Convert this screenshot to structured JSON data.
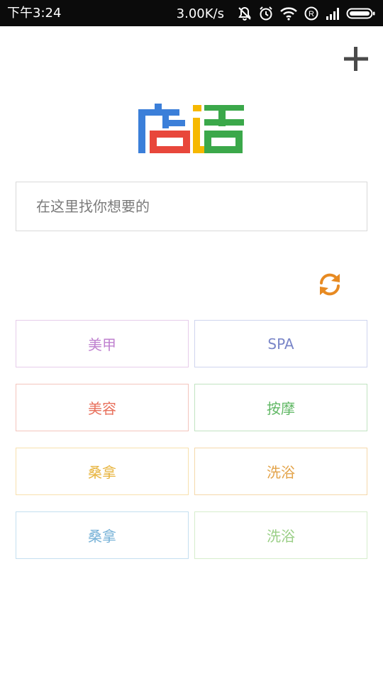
{
  "status_bar": {
    "time": "下午3:24",
    "net_speed": "3.00K/s",
    "icons": [
      "mute-icon",
      "alarm-icon",
      "wifi-icon",
      "registered-icon",
      "signal-icon",
      "battery-icon"
    ],
    "registered_glyph": "R"
  },
  "header": {
    "add_icon": "plus-icon"
  },
  "logo": {
    "text": "店话",
    "colors": {
      "blue": "#3b7fd9",
      "red": "#e8473b",
      "yellow": "#f6b800",
      "green": "#3ba84a"
    }
  },
  "search": {
    "placeholder": "在这里找你想要的",
    "value": ""
  },
  "refresh": {
    "icon": "refresh-icon",
    "color": "#e78a22"
  },
  "categories": [
    {
      "label": "美甲"
    },
    {
      "label": "SPA"
    },
    {
      "label": "美容"
    },
    {
      "label": "按摩"
    },
    {
      "label": "桑拿"
    },
    {
      "label": "洗浴"
    },
    {
      "label": "桑拿"
    },
    {
      "label": "洗浴"
    }
  ]
}
